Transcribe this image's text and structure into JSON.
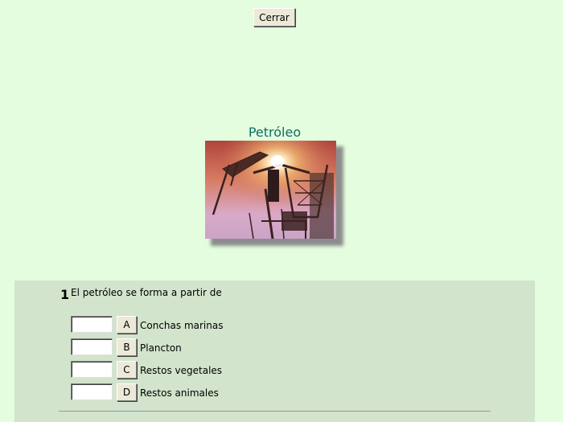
{
  "toolbar": {
    "close_label": "Cerrar"
  },
  "page": {
    "title": "Petróleo"
  },
  "question": {
    "number": "1",
    "text": "El petróleo se forma a partir de",
    "options": [
      {
        "letter": "A",
        "label": "Conchas marinas",
        "value": ""
      },
      {
        "letter": "B",
        "label": "Plancton",
        "value": ""
      },
      {
        "letter": "C",
        "label": "Restos vegetales",
        "value": ""
      },
      {
        "letter": "D",
        "label": "Restos animales",
        "value": ""
      }
    ]
  }
}
